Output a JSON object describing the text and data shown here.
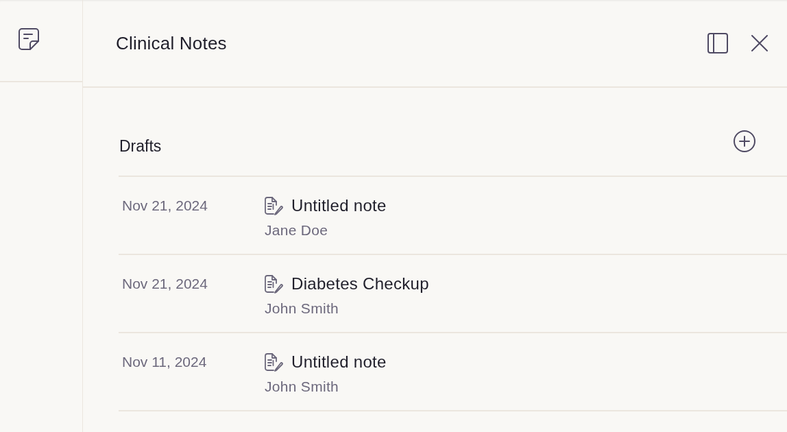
{
  "panel": {
    "title": "Clinical Notes"
  },
  "section": {
    "title": "Drafts"
  },
  "notes": [
    {
      "date": "Nov 21, 2024",
      "title": "Untitled note",
      "author": "Jane Doe"
    },
    {
      "date": "Nov 21, 2024",
      "title": "Diabetes Checkup",
      "author": "John Smith"
    },
    {
      "date": "Nov 11, 2024",
      "title": "Untitled note",
      "author": "John Smith"
    }
  ]
}
